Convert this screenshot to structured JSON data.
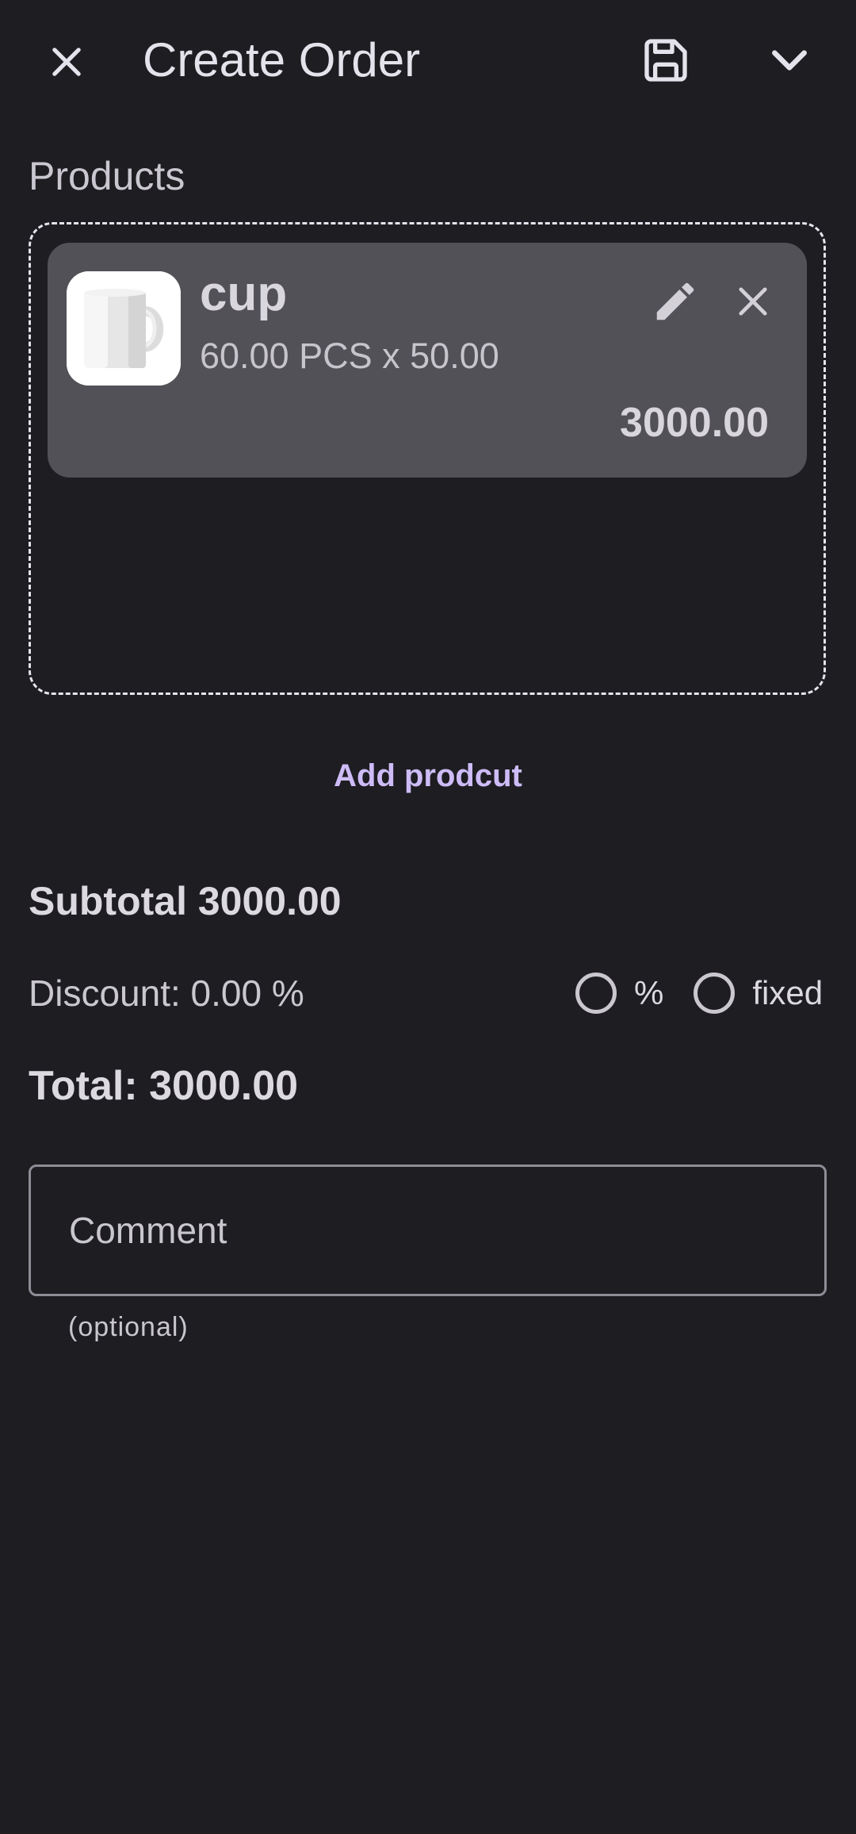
{
  "header": {
    "title": "Create Order",
    "icons": {
      "close": "close-icon",
      "save": "save-icon",
      "collapse": "chevron-down-icon"
    }
  },
  "products": {
    "section_label": "Products",
    "items": [
      {
        "name": "cup",
        "quantity_line": "60.00 PCS x 50.00",
        "total": "3000.00",
        "thumbnail": "mug-image"
      }
    ],
    "add_label": "Add prodcut"
  },
  "summary": {
    "subtotal": "Subtotal 3000.00",
    "discount": "Discount: 0.00 %",
    "discount_options": [
      {
        "label": "%",
        "selected": false
      },
      {
        "label": "fixed",
        "selected": false
      }
    ],
    "total": "Total: 3000.00"
  },
  "comment": {
    "placeholder": "Comment",
    "helper": "(optional)"
  },
  "colors": {
    "background": "#1e1d22",
    "card": "#525157",
    "accent": "#cdbcf7",
    "outline": "#8f8c95"
  }
}
